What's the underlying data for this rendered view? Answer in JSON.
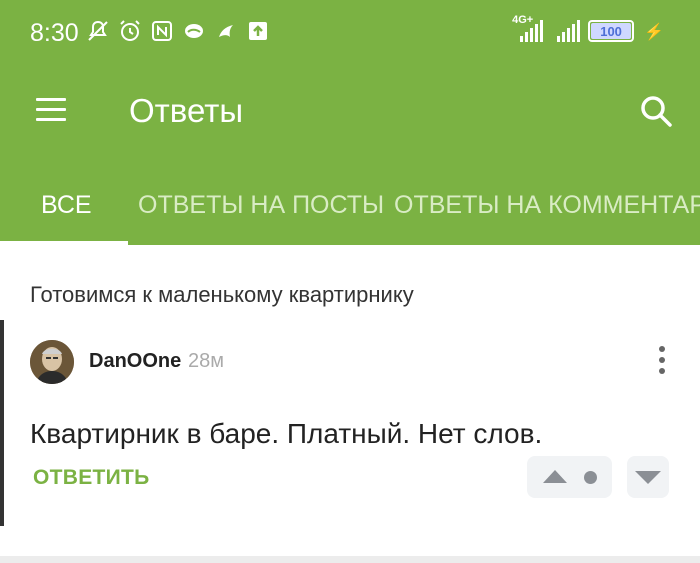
{
  "status_bar": {
    "time": "8:30",
    "network_type": "4G+",
    "battery_level": "100",
    "icons": [
      "mute-notifications-icon",
      "alarm-icon",
      "nfc-icon",
      "app-notification-icon",
      "app-notification-icon",
      "upload-icon"
    ]
  },
  "app_bar": {
    "title": "Ответы"
  },
  "tabs": [
    {
      "label": "ВСЕ",
      "active": true
    },
    {
      "label": "ОТВЕТЫ НА ПОСТЫ",
      "active": false
    },
    {
      "label": "ОТВЕТЫ НА КОММЕНТАР",
      "active": false
    }
  ],
  "post": {
    "title": "Готовимся к маленькому квартирнику"
  },
  "comment": {
    "author": "DanOOne",
    "time_ago": "28м",
    "text": "Квартирник в баре. Платный. Нет слов.",
    "reply_label": "ОТВЕТИТЬ"
  },
  "colors": {
    "accent": "#7bb243",
    "accent_text": "#7bb243",
    "vote_bg": "#f1f3f5"
  }
}
